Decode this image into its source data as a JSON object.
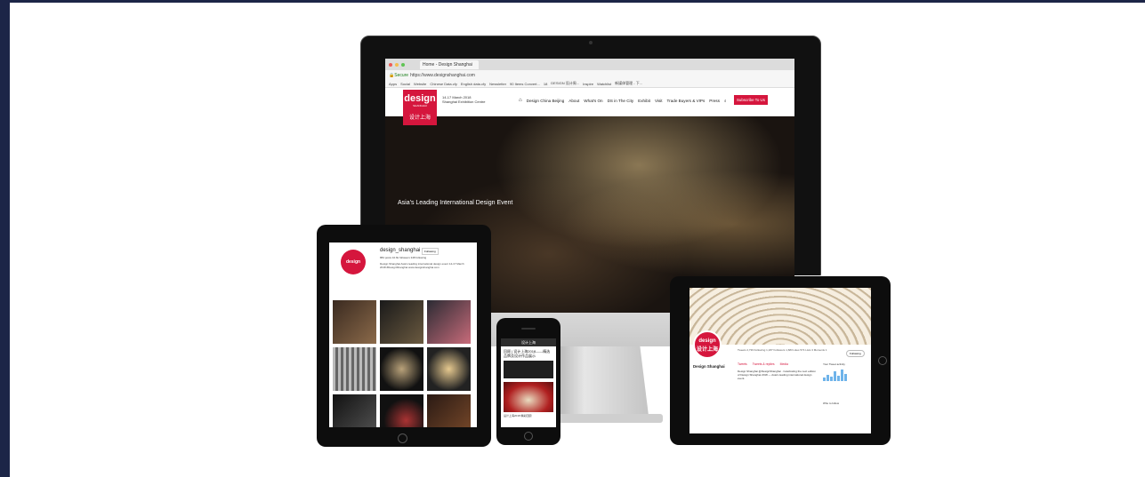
{
  "browser": {
    "tab_title": "Home - Design Shanghai",
    "secure_label": "Secure",
    "url": "https://www.designshanghai.com",
    "bookmarks": [
      "Apps",
      "Social",
      "Website",
      "Chinese Data.cfy",
      "English data.cfy",
      "Newsletter",
      "90 Items Convert...",
      "18",
      "DESIGN 设计周...",
      "Inspire",
      "Watchlist",
      "新媒体管理 - 下..."
    ]
  },
  "site": {
    "logo_word": "design",
    "logo_sub": "SHANGHAI",
    "logo_cn": "设计上海",
    "dates_line1": "14-17 March 2018",
    "dates_line2": "Shanghai Exhibition Centre",
    "nav": [
      "Design China Beijing",
      "About",
      "What's On",
      "DS in The City",
      "Exhibit",
      "Visit",
      "Trade Buyers & VIPs",
      "Press"
    ],
    "subscribe": "Subscribe To Us",
    "tagline": "Asia's Leading International Design Event"
  },
  "instagram": {
    "username": "design_shanghai",
    "follow": "Following",
    "stats": "884 posts   10.6k followers   348 following",
    "bio": "Design Shanghai Asia's leading international design event 14-17 March 2018 #DesignShanghai www.designshanghai.com",
    "avatar_word": "design",
    "avatar_cn": "设计上海"
  },
  "wechat": {
    "header": "设计上海",
    "title": "回顾 | 设计上海2018——精选品牌及设计作品展示",
    "caption": "设计上海2018 精彩回顾"
  },
  "twitter": {
    "avatar_word": "design",
    "avatar_cn": "设计上海",
    "name": "Design Shanghai",
    "stats": "Tweets 2,739   Following 1,187   Followers 1,683   Likes 574   Lists 3   Moments 1",
    "follow_button": "Following",
    "tabs": [
      "Tweets",
      "Tweets & replies",
      "Media"
    ],
    "tweet": "Design Shanghai @DesignShanghai · Celebrating the next edition of Design Shanghai 2018 — Asia's leading international design event.",
    "side_title": "Your Tweet activity",
    "who_to_follow": "Who to follow"
  },
  "colors": {
    "brand_red": "#d5163d",
    "page_border": "#1c2547"
  }
}
